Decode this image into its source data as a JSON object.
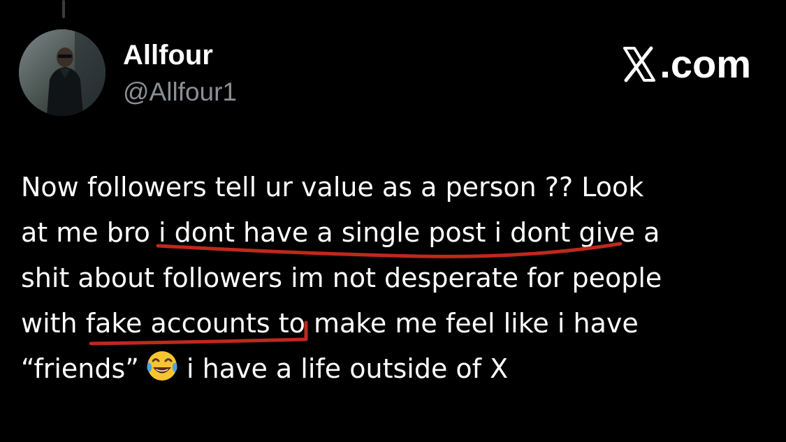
{
  "author": {
    "display_name": "Allfour",
    "handle": "@Allfour1",
    "avatar": "profile-photo"
  },
  "watermark": {
    "text": ".com",
    "icon": "x-logo-icon"
  },
  "tweet": {
    "line1": "Now followers tell ur value as a person ?? Look",
    "line2": "at me bro i dont have a single post i dont give a",
    "line3": "shit about followers im not desperate for people",
    "line4": "with fake accounts to make me feel like i have",
    "line5_before": "“friends”",
    "line5_emoji": "face-with-tears-of-joy",
    "line5_after": "i have a life outside of X"
  },
  "annotations": {
    "underline_color": "#c0281d",
    "underlined_phrases": [
      "i dont have a single post i dont",
      "fake accounts"
    ]
  },
  "colors": {
    "background": "#000000",
    "text": "#ffffff",
    "handle": "#8b9096"
  }
}
